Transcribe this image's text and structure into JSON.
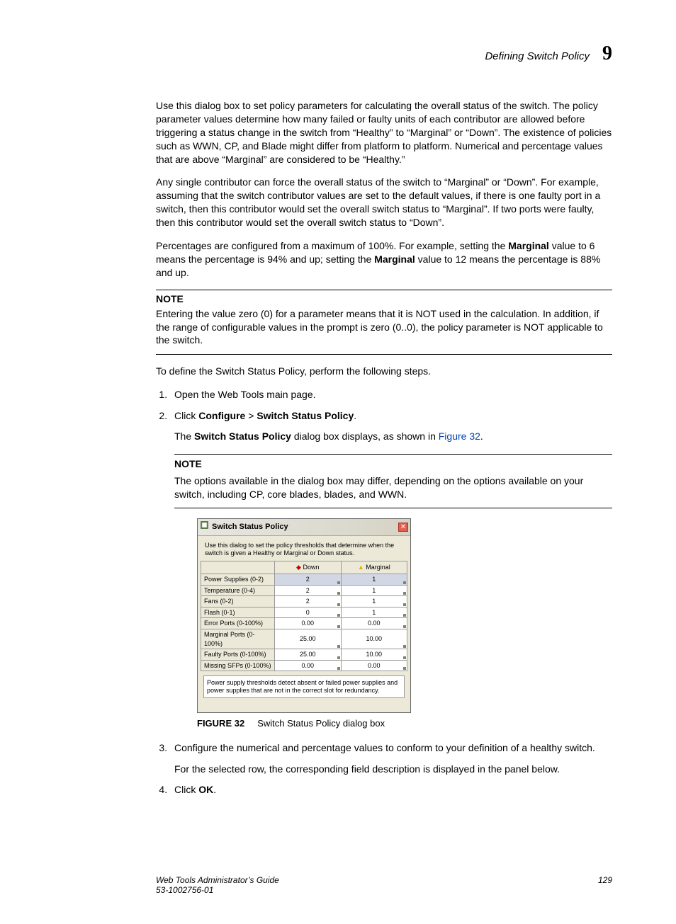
{
  "header": {
    "title": "Defining Switch Policy",
    "chapter": "9"
  },
  "para1_a": "Use this dialog box to set policy parameters for calculating the overall status of the switch. The policy parameter values determine how many failed or faulty units of each contributor are allowed before triggering a status change in the switch from “Healthy” to “Marginal” or “Down”. The existence of policies such as WWN, CP, and Blade might differ from platform to platform. Numerical and percentage values that are above “Marginal” are considered to be “Healthy.”",
  "para2": "Any single contributor can force the overall status of the switch to “Marginal” or “Down”. For example, assuming that the switch contributor values are set to the default values, if there is one faulty port in a switch, then this contributor would set the overall switch status to “Marginal”. If two ports were faulty, then this contributor would set the overall switch status to “Down”.",
  "para3_a": "Percentages are configured from a maximum of 100%. For example, setting the ",
  "para3_b": "Marginal",
  "para3_c": " value to 6 means the percentage is 94% and up; setting the ",
  "para3_d": "Marginal",
  "para3_e": " value to 12 means the percentage is 88% and up.",
  "note1_head": "NOTE",
  "note1_body": "Entering the value zero (0) for a parameter means that it is NOT used in the calculation. In addition, if the range of configurable values in the prompt is zero (0..0), the policy parameter is NOT applicable to the switch.",
  "para4": "To define the Switch Status Policy, perform the following steps.",
  "steps": {
    "s1": "Open the Web Tools main page.",
    "s2_a": "Click ",
    "s2_b": "Configure",
    "s2_c": " > ",
    "s2_d": "Switch Status Policy",
    "s2_e": ".",
    "s2_sub_a": "The ",
    "s2_sub_b": "Switch Status Policy",
    "s2_sub_c": " dialog box displays, as shown in ",
    "s2_sub_link": "Figure 32",
    "s2_sub_d": ".",
    "s3": "Configure the numerical and percentage values to conform to your definition of a healthy switch.",
    "s3_sub": "For the selected row, the corresponding field description is displayed in the panel below.",
    "s4_a": "Click ",
    "s4_b": "OK",
    "s4_c": "."
  },
  "note2_head": "NOTE",
  "note2_body": "The options available in the dialog box may differ, depending on the options available on your switch, including CP, core blades, blades, and WWN.",
  "dialog": {
    "title": "Switch Status Policy",
    "desc": "Use this dialog to set the policy thresholds that determine when the switch is given a Healthy or Marginal or Down status.",
    "col0": "",
    "col1": "Down",
    "col2": "Marginal",
    "rows": [
      {
        "name": "Power Supplies (0-2)",
        "down": "2",
        "marg": "1",
        "sel": true
      },
      {
        "name": "Temperature (0-4)",
        "down": "2",
        "marg": "1"
      },
      {
        "name": "Fans (0-2)",
        "down": "2",
        "marg": "1"
      },
      {
        "name": "Flash (0-1)",
        "down": "0",
        "marg": "1"
      },
      {
        "name": "Error Ports (0-100%)",
        "down": "0.00",
        "marg": "0.00"
      },
      {
        "name": "Marginal Ports (0-100%)",
        "down": "25.00",
        "marg": "10.00"
      },
      {
        "name": "Faulty Ports (0-100%)",
        "down": "25.00",
        "marg": "10.00"
      },
      {
        "name": "Missing SFPs (0-100%)",
        "down": "0.00",
        "marg": "0.00"
      }
    ],
    "footer": "Power supply thresholds detect absent or failed power supplies and power supplies that are not in the correct slot for redundancy."
  },
  "fig": {
    "label": "FIGURE 32",
    "caption": "Switch Status Policy dialog box"
  },
  "footer": {
    "book": "Web Tools Administrator’s Guide",
    "doc": "53-1002756-01",
    "page": "129"
  }
}
